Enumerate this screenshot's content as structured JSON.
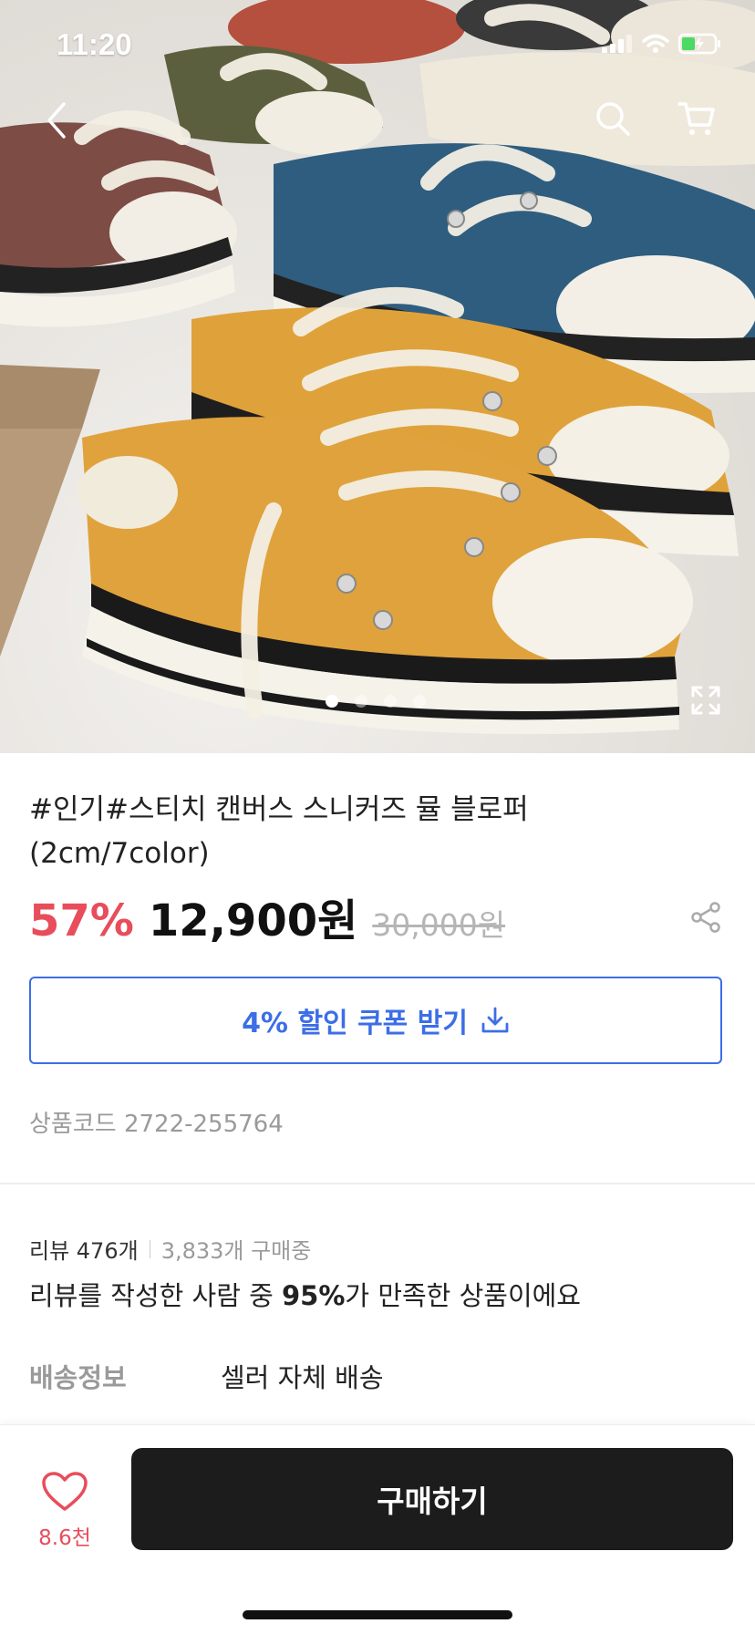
{
  "status_bar": {
    "time": "11:20"
  },
  "gallery": {
    "image_description_icon": "product-photo-sneakers",
    "dot_count": 4,
    "active_index": 0
  },
  "product": {
    "title": "#인기#스티치 캔버스 스니커즈 뮬 블로퍼(2cm/7color)",
    "discount": "57%",
    "price": "12,900원",
    "original_price": "30,000원",
    "coupon_label": "4% 할인 쿠폰 받기",
    "product_code": "상품코드 2722-255764"
  },
  "review": {
    "count_label": "리뷰 476개",
    "buyers_label": "3,833개 구매중",
    "satisfaction_prefix": "리뷰를 작성한 사람 중 ",
    "satisfaction_value": "95%",
    "satisfaction_suffix": "가 만족한 상품이에요"
  },
  "shipping": {
    "label": "배송정보",
    "value": "셀러 자체 배송"
  },
  "bottom_bar": {
    "like_count": "8.6천",
    "buy_label": "구매하기"
  },
  "colors": {
    "accent_red": "#e84d5b",
    "accent_blue": "#3c6ee6",
    "buy_button": "#1c1c1c"
  }
}
